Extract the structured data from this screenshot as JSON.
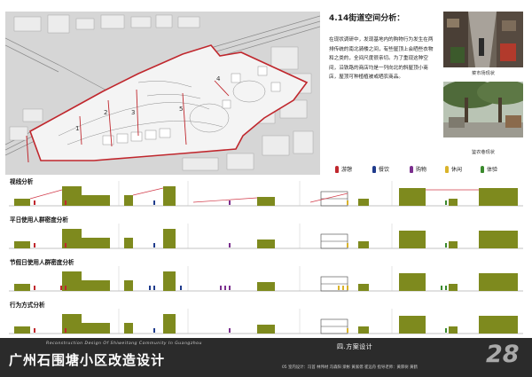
{
  "analysis": {
    "title": "4.14街道空间分析：",
    "body": "在现状调研中，发现基地内的购物行为发生在两排传统的南北骑楼之间，有些屋顶上会晒些衣物和之类的，全间尺度很亲切。为了重现这种空间，沿铁路的商店均是一列向北的斜屋顶小商店，屋顶可种植植被或晒农商品。"
  },
  "photos": [
    {
      "caption": "菜市场现状"
    },
    {
      "caption": "鉴农巷现状"
    }
  ],
  "map": {
    "section_marks": [
      "1",
      "2",
      "3",
      "4",
      "5"
    ]
  },
  "legend": [
    {
      "label": "游憩",
      "color": "#c0272d"
    },
    {
      "label": "餐饮",
      "color": "#1f3b8c"
    },
    {
      "label": "购物",
      "color": "#7b2f8e"
    },
    {
      "label": "休闲",
      "color": "#d9b32a"
    },
    {
      "label": "体验",
      "color": "#3a8a2d"
    }
  ],
  "rows": [
    {
      "label": "视线分析"
    },
    {
      "label": "平日使用人群密度分析"
    },
    {
      "label": "节假日使用人群密度分析"
    },
    {
      "label": "行为方式分析"
    }
  ],
  "footer": {
    "title": "广州石围塘小区改造设计",
    "subtitle_en": "Reconstruction Design Of Shiweitang Community In Guangzhou",
    "plan": "四.方案设计",
    "credits": "05 室内设计：冯首  林伟材  冯森阳  梁彬  黄家偲  崔远舟     指导老师：黄厚树  黄鹤",
    "page_number": "28"
  },
  "colors": {
    "building": "#7e8a1e",
    "sight_line": "#d23b4a",
    "site_boundary": "#c0272d",
    "footer_bg": "#2b2b2b"
  }
}
